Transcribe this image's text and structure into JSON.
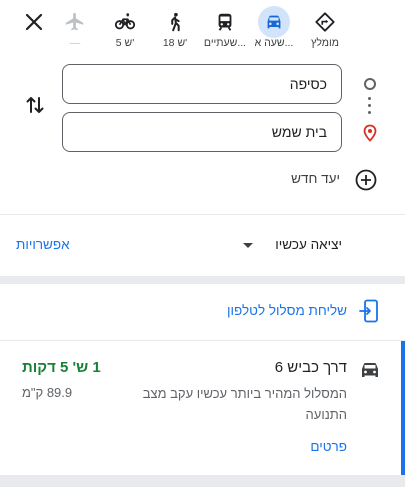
{
  "travel_modes": [
    {
      "id": "best",
      "icon": "directions-diamond-icon",
      "label": "מומלץ",
      "active": false
    },
    {
      "id": "drive",
      "icon": "car-icon",
      "label": "שעה א...",
      "active": true
    },
    {
      "id": "transit",
      "icon": "train-icon",
      "label": "שעתיים...",
      "active": false
    },
    {
      "id": "walk",
      "icon": "walking-icon",
      "label": "18 ש'",
      "active": false
    },
    {
      "id": "bike",
      "icon": "bicycle-icon",
      "label": "5 ש'",
      "active": false
    },
    {
      "id": "flight",
      "icon": "airplane-icon",
      "label": "—",
      "active": false
    }
  ],
  "origin": {
    "value": "כסיפה"
  },
  "destination": {
    "value": "בית שמש"
  },
  "add_destination": {
    "label": "יעד חדש"
  },
  "depart": {
    "label": "יציאה עכשיו"
  },
  "options": {
    "label": "אפשרויות"
  },
  "send_to_phone": {
    "label": "שליחת מסלול לטלפון"
  },
  "route": {
    "name": "דרך כביש 6",
    "description": "המסלול המהיר ביותר עכשיו עקב מצב התנועה",
    "duration": "1 ש' 5 דקות",
    "distance": "89.9 ק\"מ",
    "details_label": "פרטים"
  },
  "colors": {
    "accent": "#1a73e8",
    "active_mode_bg": "#d2e3fc",
    "duration": "#188038"
  }
}
